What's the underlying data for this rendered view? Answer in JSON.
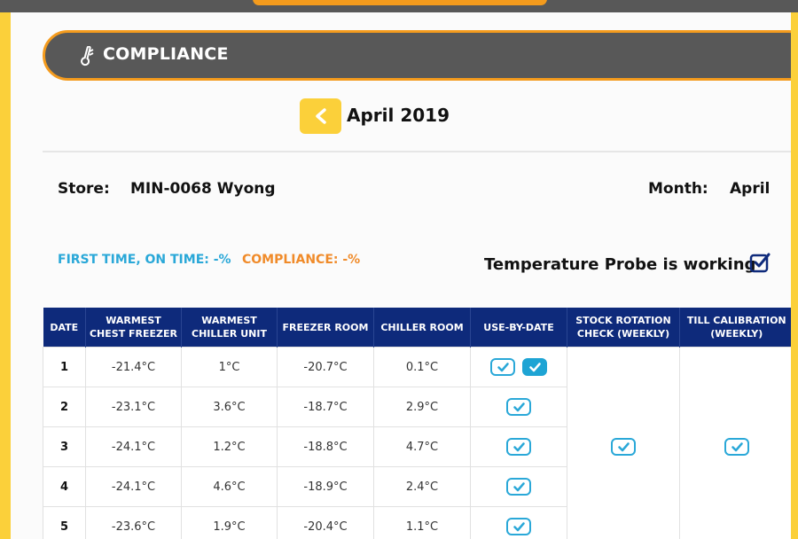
{
  "header": {
    "title": "COMPLIANCE",
    "icon": "thermometer-icon"
  },
  "nav": {
    "month_label": "April 2019",
    "prev_icon": "chevron-left-icon"
  },
  "store": {
    "label": "Store:",
    "value": "MIN-0068 Wyong"
  },
  "month": {
    "label": "Month:",
    "value": "April"
  },
  "stats": {
    "first_time_on_time": "FIRST TIME, ON TIME: -%",
    "compliance": "COMPLIANCE: -%"
  },
  "probe": {
    "label": "Temperature Probe is working",
    "checked": true
  },
  "colors": {
    "frame": "#fbd03a",
    "header_bg": "#585858",
    "header_border": "#f49b1d",
    "table_header": "#0e2a7b",
    "accent_blue": "#2aa8d8",
    "accent_orange": "#f08b2a"
  },
  "table": {
    "columns": [
      "DATE",
      "WARMEST CHEST FREEZER",
      "WARMEST CHILLER UNIT",
      "FREEZER ROOM",
      "CHILLER ROOM",
      "USE-BY-DATE",
      "STOCK ROTATION CHECK (WEEKLY)",
      "TILL CALIBRATION (WEEKLY)"
    ],
    "rows": [
      {
        "date": "1",
        "chest_freezer": "-21.4°C",
        "chiller_unit": "1°C",
        "freezer_room": "-20.7°C",
        "chiller_room": "0.1°C",
        "use_by": [
          "checked",
          "checked-filled"
        ]
      },
      {
        "date": "2",
        "chest_freezer": "-23.1°C",
        "chiller_unit": "3.6°C",
        "freezer_room": "-18.7°C",
        "chiller_room": "2.9°C",
        "use_by": [
          "checked"
        ]
      },
      {
        "date": "3",
        "chest_freezer": "-24.1°C",
        "chiller_unit": "1.2°C",
        "freezer_room": "-18.8°C",
        "chiller_room": "4.7°C",
        "use_by": [
          "checked"
        ]
      },
      {
        "date": "4",
        "chest_freezer": "-24.1°C",
        "chiller_unit": "4.6°C",
        "freezer_room": "-18.9°C",
        "chiller_room": "2.4°C",
        "use_by": [
          "checked"
        ]
      },
      {
        "date": "5",
        "chest_freezer": "-23.6°C",
        "chiller_unit": "1.9°C",
        "freezer_room": "-20.4°C",
        "chiller_room": "1.1°C",
        "use_by": [
          "checked"
        ]
      }
    ],
    "weekly": {
      "stock_rotation": "checked",
      "till_calibration": "checked"
    }
  }
}
